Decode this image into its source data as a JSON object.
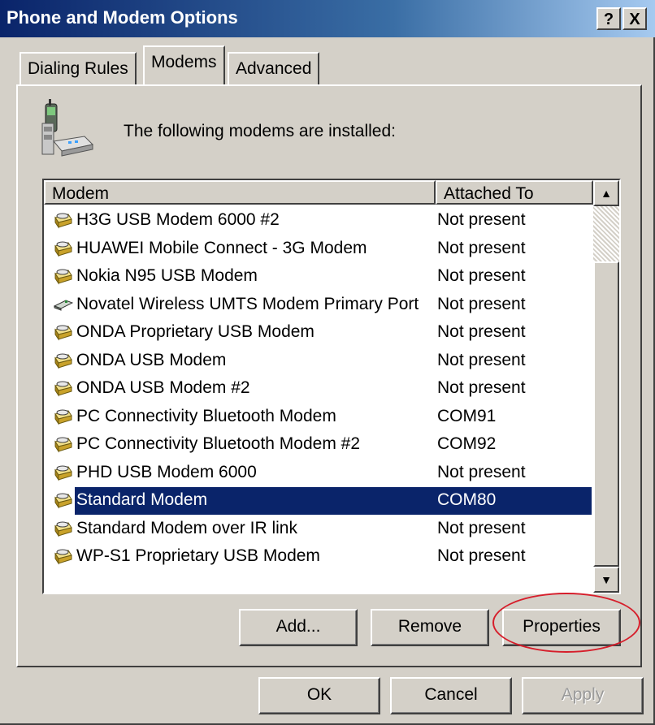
{
  "window": {
    "title": "Phone and Modem Options",
    "help_glyph": "?",
    "close_glyph": "X"
  },
  "tabs": [
    {
      "label": "Dialing Rules",
      "active": false
    },
    {
      "label": "Modems",
      "active": true
    },
    {
      "label": "Advanced",
      "active": false
    }
  ],
  "panel": {
    "info_text": "The following modems are  installed:",
    "icon": "phone-modem-icon"
  },
  "list": {
    "columns": [
      "Modem",
      "Attached To"
    ],
    "rows": [
      {
        "name": "H3G USB Modem 6000 #2",
        "attached": "Not present",
        "icon": "modem-icon"
      },
      {
        "name": "HUAWEI Mobile Connect - 3G Modem",
        "attached": "Not present",
        "icon": "modem-icon"
      },
      {
        "name": "Nokia N95 USB Modem",
        "attached": "Not present",
        "icon": "modem-icon"
      },
      {
        "name": "Novatel Wireless UMTS Modem Primary Port",
        "attached": "Not present",
        "icon": "pcmcia-card-icon"
      },
      {
        "name": "ONDA Proprietary USB Modem",
        "attached": "Not present",
        "icon": "modem-icon"
      },
      {
        "name": "ONDA USB Modem",
        "attached": "Not present",
        "icon": "modem-icon"
      },
      {
        "name": "ONDA USB Modem  #2",
        "attached": "Not present",
        "icon": "modem-icon"
      },
      {
        "name": "PC Connectivity Bluetooth Modem",
        "attached": "COM91",
        "icon": "modem-icon"
      },
      {
        "name": "PC Connectivity Bluetooth Modem #2",
        "attached": "COM92",
        "icon": "modem-icon"
      },
      {
        "name": "PHD USB Modem 6000",
        "attached": "Not present",
        "icon": "modem-icon"
      },
      {
        "name": "Standard Modem",
        "attached": "COM80",
        "icon": "modem-icon",
        "selected": true
      },
      {
        "name": "Standard Modem over IR link",
        "attached": "Not present",
        "icon": "modem-icon"
      },
      {
        "name": "WP-S1 Proprietary USB Modem",
        "attached": "Not present",
        "icon": "modem-icon"
      }
    ]
  },
  "buttons": {
    "add": "Add...",
    "remove": "Remove",
    "properties": "Properties",
    "ok": "OK",
    "cancel": "Cancel",
    "apply": "Apply"
  },
  "colors": {
    "selection": "#0a246a",
    "annotation": "#d61e2b",
    "face": "#d4d0c8"
  }
}
